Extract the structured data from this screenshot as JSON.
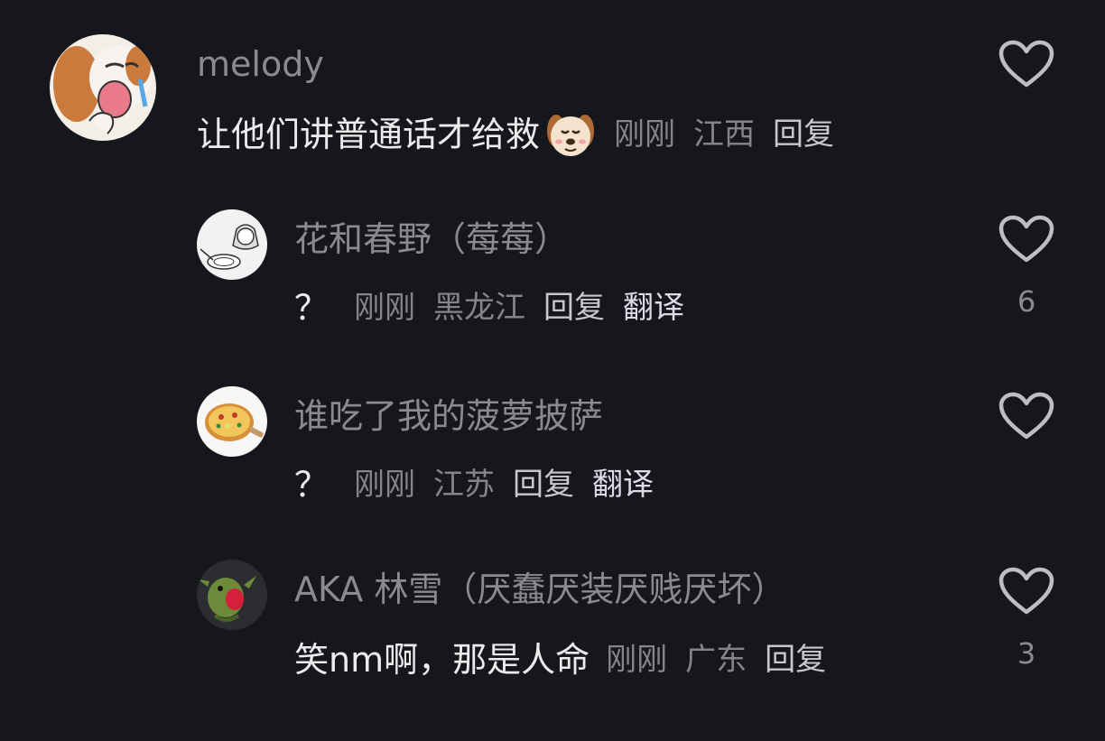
{
  "comments": [
    {
      "username": "melody",
      "text": "让他们讲普通话才给救",
      "time": "刚刚",
      "location": "江西",
      "reply_label": "回复",
      "like_count": ""
    },
    {
      "username": "花和春野（莓莓）",
      "text": "？",
      "time": "刚刚",
      "location": "黑龙江",
      "reply_label": "回复",
      "translate_label": "翻译",
      "like_count": "6"
    },
    {
      "username": "谁吃了我的菠萝披萨",
      "text": "？",
      "time": "刚刚",
      "location": "江苏",
      "reply_label": "回复",
      "translate_label": "翻译",
      "like_count": ""
    },
    {
      "username": "AKA 林雪（厌蠢厌装厌贱厌坏）",
      "text": "笑nm啊，那是人命",
      "time": "刚刚",
      "location": "广东",
      "reply_label": "回复",
      "like_count": "3"
    }
  ],
  "colors": {
    "background": "#16161d",
    "username": "#8a8a92",
    "text": "#ececec",
    "meta": "#84848c"
  },
  "icons": {
    "like": "heart-outline-icon",
    "emoji": "dog-face-emoji"
  }
}
